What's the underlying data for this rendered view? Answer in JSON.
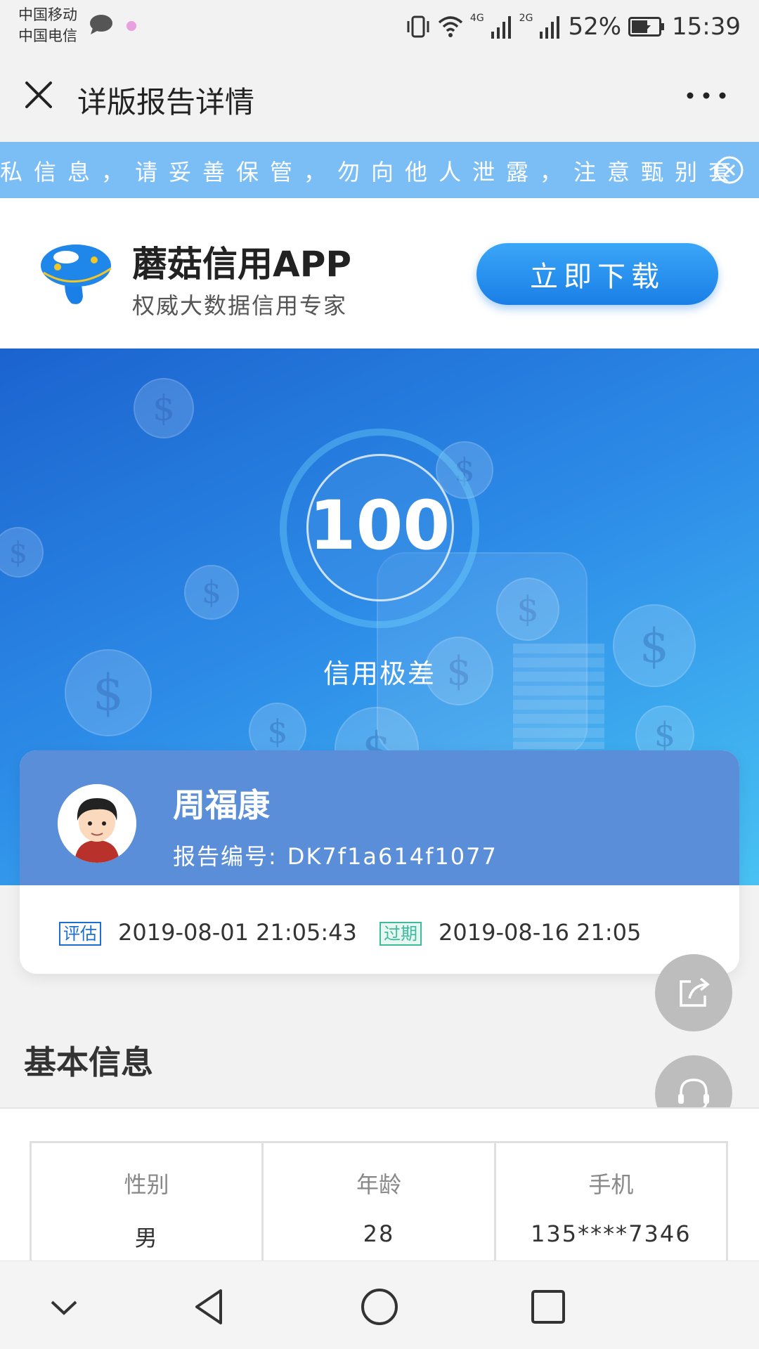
{
  "status_bar": {
    "carrier_1": "中国移动",
    "carrier_2": "中国电信",
    "network_1": "4G",
    "network_2": "2G",
    "battery": "52%",
    "time": "15:39"
  },
  "title_bar": {
    "title": "详版报告详情"
  },
  "notice": {
    "text": "私信息，请妥善保管，勿向他人泄露，注意甄别套"
  },
  "app_banner": {
    "name": "蘑菇信用APP",
    "slogan": "权威大数据信用专家",
    "download_label": "立即下载"
  },
  "hero": {
    "score": "100",
    "level": "信用极差"
  },
  "profile": {
    "name": "周福康",
    "report_label": "报告编号:",
    "report_no": "DK7f1a614f1077",
    "eval_tag": "评估",
    "eval_date": "2019-08-01 21:05:43",
    "expire_tag": "过期",
    "expire_date": "2019-08-16 21:05"
  },
  "basic_info": {
    "title": "基本信息",
    "fields": [
      {
        "label": "性别",
        "value": "男"
      },
      {
        "label": "年龄",
        "value": "28"
      },
      {
        "label": "手机",
        "value": "135****7346"
      }
    ]
  },
  "colors": {
    "accent": "#1a7fe6",
    "hero_start": "#1b63cf",
    "hero_end": "#49c2f3",
    "notice_bg": "#7bbef6",
    "expire_tag": "#3dbb9b"
  }
}
